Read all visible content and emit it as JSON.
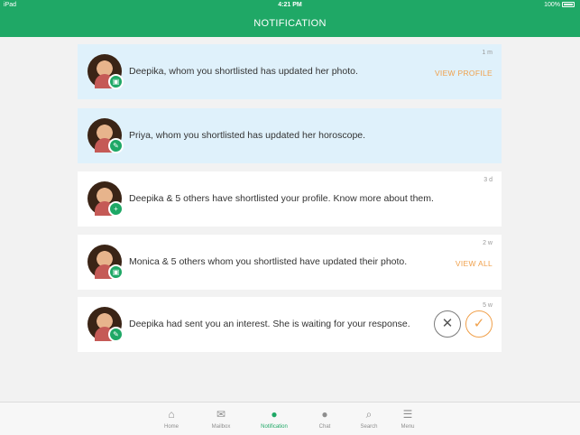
{
  "status_bar": {
    "device": "iPad",
    "time": "4:21 PM",
    "battery": "100%"
  },
  "header": {
    "title": "NOTIFICATION"
  },
  "notifications": [
    {
      "text": "Deepika, whom you shortlisted has updated her photo.",
      "time": "1 m",
      "action": "VIEW PROFILE",
      "unread": true,
      "badge_icon": "photo-icon"
    },
    {
      "text": "Priya, whom you shortlisted has updated her horoscope.",
      "time": "",
      "action": "",
      "unread": true,
      "badge_icon": "horoscope-icon"
    },
    {
      "text": "Deepika & 5 others have shortlisted your profile. Know more about them.",
      "time": "3 d",
      "action": "",
      "unread": false,
      "badge_icon": "add-user-icon"
    },
    {
      "text": "Monica & 5 others whom you shortlisted have updated their photo.",
      "time": "2 w",
      "action": "VIEW ALL",
      "unread": false,
      "badge_icon": "photo-icon"
    },
    {
      "text": "Deepika had sent you an interest. She is waiting for your response.",
      "time": "5 w",
      "action": "",
      "unread": false,
      "badge_icon": "interest-icon"
    }
  ],
  "tabs": [
    {
      "label": "Home",
      "icon": "home-icon"
    },
    {
      "label": "Mailbox",
      "icon": "mail-icon"
    },
    {
      "label": "Notification",
      "icon": "bell-icon",
      "active": true
    },
    {
      "label": "Chat",
      "icon": "chat-icon"
    },
    {
      "label": "Search",
      "icon": "search-icon"
    },
    {
      "label": "Menu",
      "icon": "menu-icon"
    }
  ],
  "colors": {
    "brand": "#1fa866",
    "accent": "#f0a04b",
    "unread_bg": "#dff1fb"
  }
}
